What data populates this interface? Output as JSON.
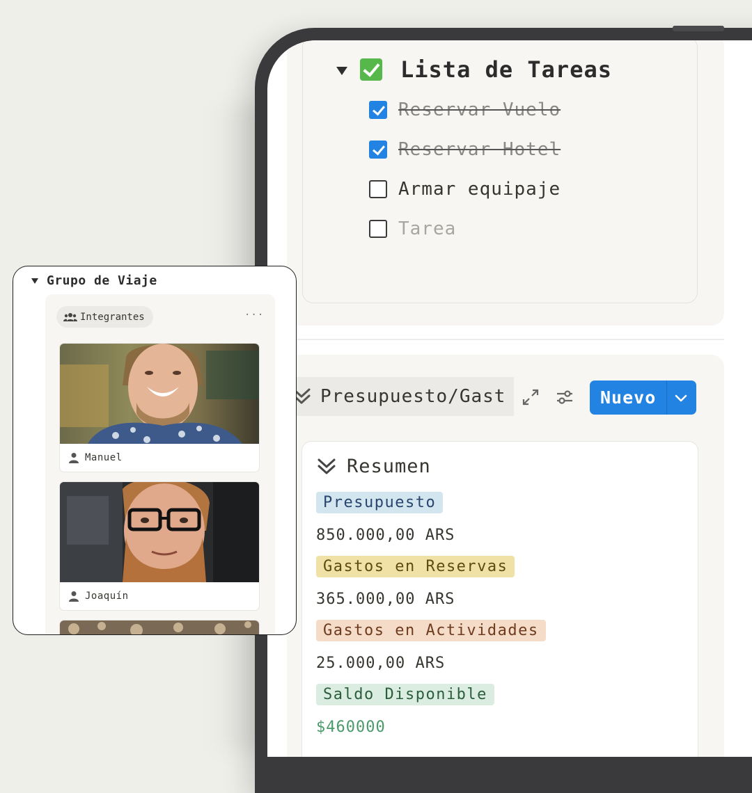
{
  "tasks": {
    "title": "Lista de Tareas",
    "items": [
      {
        "label": "Reservar Vuelo",
        "checked": true
      },
      {
        "label": "Reservar Hotel",
        "checked": true
      },
      {
        "label": "Armar equipaje",
        "checked": false
      },
      {
        "label": "Tarea",
        "checked": false,
        "placeholder": true
      }
    ]
  },
  "budget": {
    "view_tab": "Presupuesto/Gast",
    "expand_icon": "expand-icon",
    "filter_icon": "sliders-icon",
    "new_button": "Nuevo",
    "summary": {
      "title": "Resumen",
      "rows": [
        {
          "tag": "Presupuesto",
          "color": "#d3e5ef",
          "value": "850.000,00 ARS"
        },
        {
          "tag": "Gastos en Reservas",
          "color": "#f0e2a6",
          "value": "365.000,00 ARS"
        },
        {
          "tag": "Gastos en Actividades",
          "color": "#f5dcc9",
          "value": "25.000,00 ARS"
        },
        {
          "tag": "Saldo Disponible",
          "color": "#dbede1",
          "value": "$460000"
        }
      ]
    }
  },
  "group": {
    "title": "Grupo de Viaje",
    "view_label": "Integrantes",
    "more": "···",
    "members": [
      {
        "name": "Manuel"
      },
      {
        "name": "Joaquín"
      }
    ]
  },
  "colors": {
    "accent": "#2383e2",
    "check_green": "#56b84a",
    "device_frame": "#3a3a3c",
    "background": "#efefea"
  }
}
